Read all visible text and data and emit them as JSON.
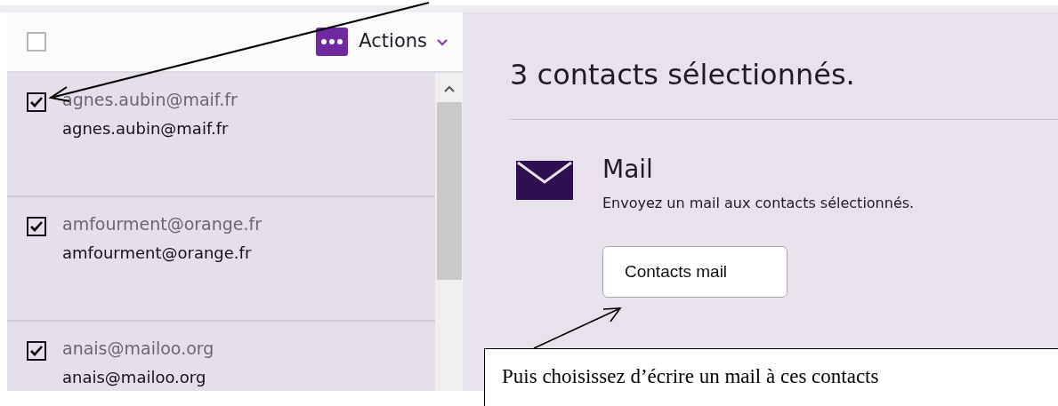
{
  "header": {
    "select_all": {
      "checked": false
    },
    "actions_label": "Actions"
  },
  "contacts": [
    {
      "name": "agnes.aubin@maif.fr",
      "email": "agnes.aubin@maif.fr",
      "checked": true
    },
    {
      "name": "amfourment@orange.fr",
      "email": "amfourment@orange.fr",
      "checked": true
    },
    {
      "name": "anais@mailoo.org",
      "email": "anais@mailoo.org",
      "checked": true
    }
  ],
  "detail": {
    "title": "3 contacts sélectionnés.",
    "section_title": "Mail",
    "description": "Envoyez un mail aux contacts sélectionnés.",
    "button": "Contacts mail"
  },
  "callout": {
    "text": "Puis choisissez d’écrire un mail à ces contacts"
  }
}
